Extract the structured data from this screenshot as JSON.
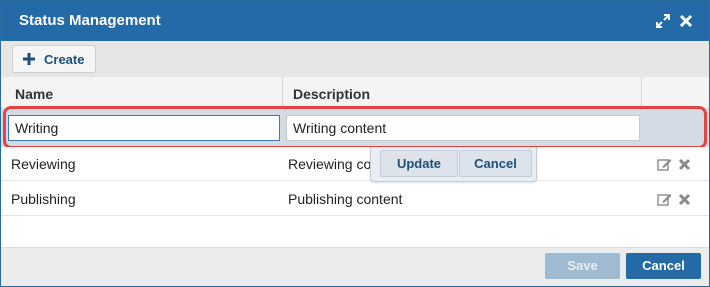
{
  "window": {
    "title": "Status Management"
  },
  "toolbar": {
    "create_label": "Create"
  },
  "grid": {
    "columns": [
      "Name",
      "Description"
    ],
    "edit_row": {
      "name_value": "Writing",
      "description_value": "Writing content"
    },
    "rows": [
      {
        "name": "Reviewing",
        "description": "Reviewing co"
      },
      {
        "name": "Publishing",
        "description": "Publishing content"
      }
    ],
    "inline_actions": {
      "update_label": "Update",
      "cancel_label": "Cancel"
    }
  },
  "footer": {
    "save_label": "Save",
    "cancel_label": "Cancel"
  },
  "colors": {
    "titlebar": "#246aa6",
    "highlight": "#e0463f",
    "primary_button": "#246aa6",
    "disabled_button": "#9fbbd2"
  },
  "icons": [
    "maximize-icon",
    "close-icon",
    "plus-icon",
    "edit-icon",
    "delete-icon"
  ]
}
